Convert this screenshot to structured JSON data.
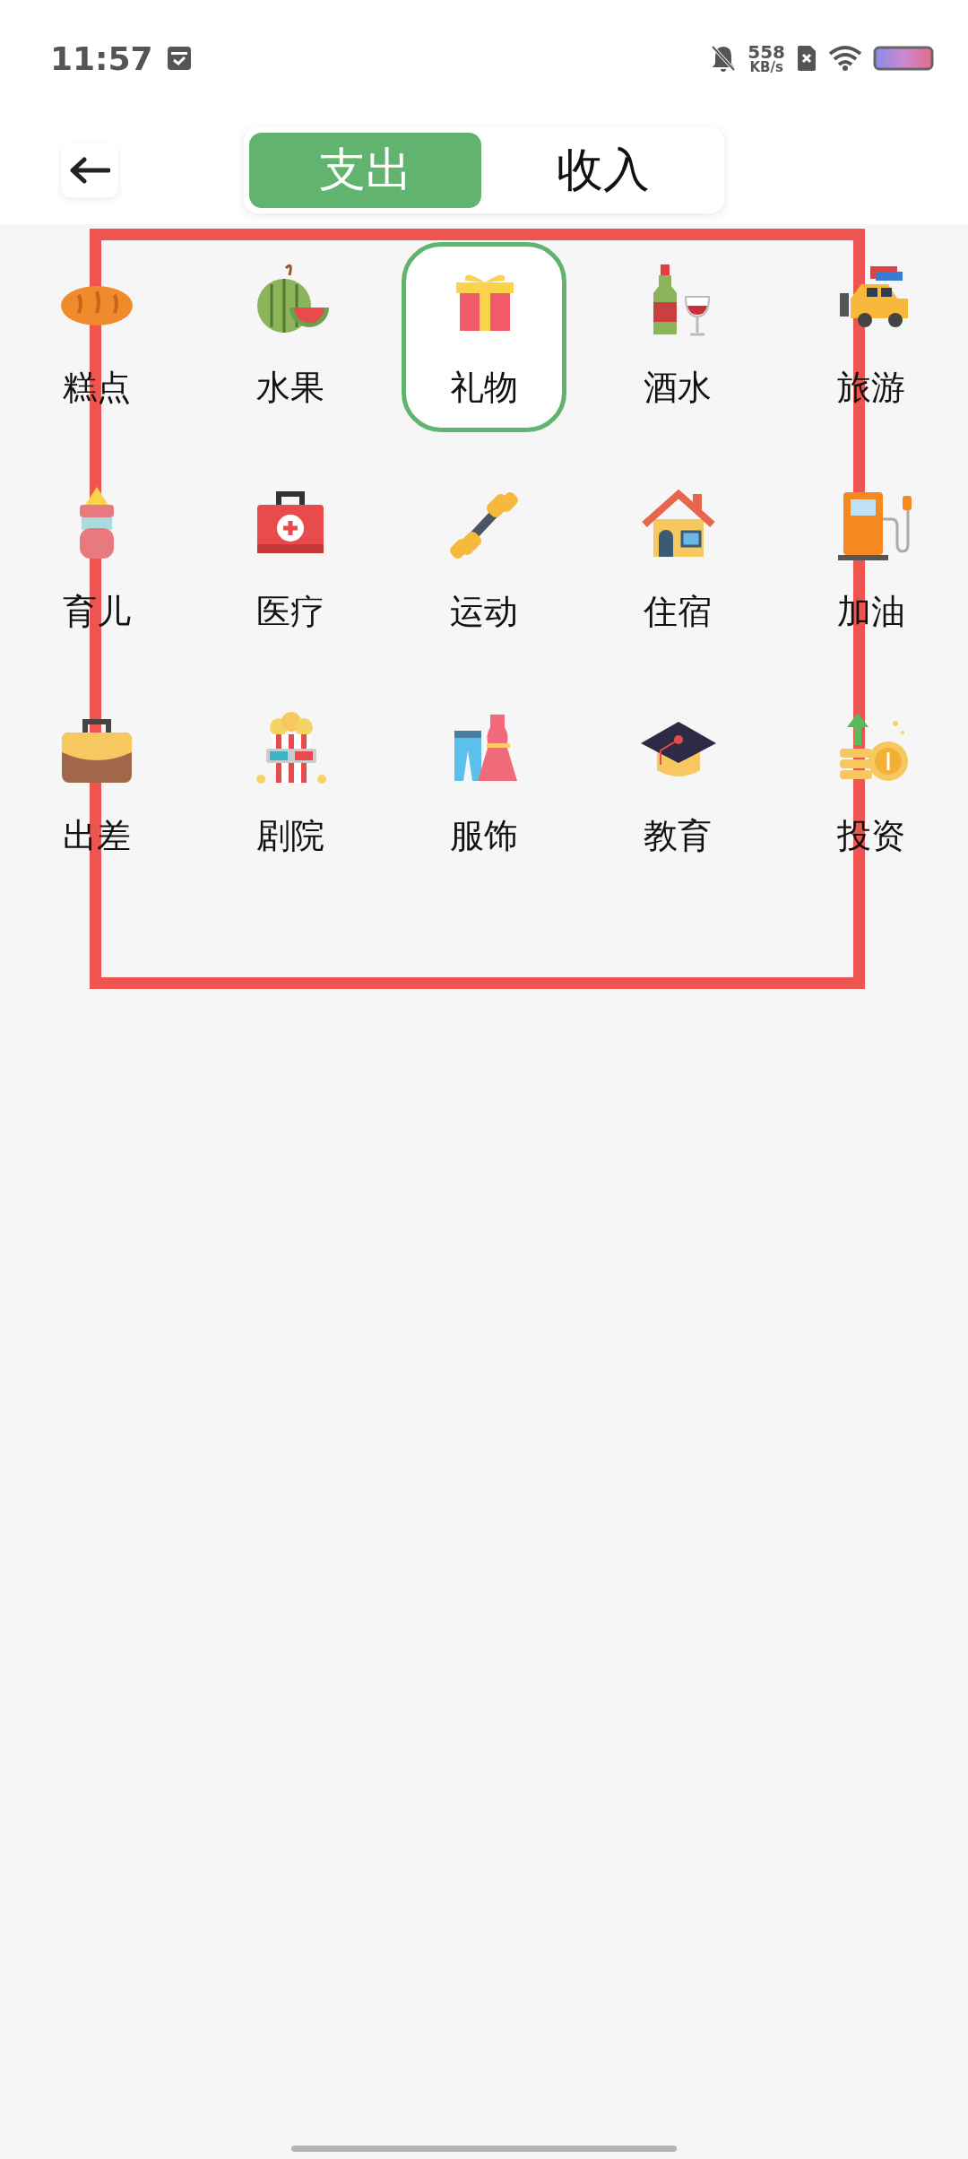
{
  "status_bar": {
    "time": "11:57",
    "speed_value": "558",
    "speed_unit": "KB/s"
  },
  "header": {
    "tabs": [
      {
        "label": "支出",
        "selected": true
      },
      {
        "label": "收入",
        "selected": false
      }
    ]
  },
  "categories": [
    {
      "label": "糕点",
      "selected": false
    },
    {
      "label": "水果",
      "selected": false
    },
    {
      "label": "礼物",
      "selected": true
    },
    {
      "label": "酒水",
      "selected": false
    },
    {
      "label": "旅游",
      "selected": false
    },
    {
      "label": "育儿",
      "selected": false
    },
    {
      "label": "医疗",
      "selected": false
    },
    {
      "label": "运动",
      "selected": false
    },
    {
      "label": "住宿",
      "selected": false
    },
    {
      "label": "加油",
      "selected": false
    },
    {
      "label": "出差",
      "selected": false
    },
    {
      "label": "剧院",
      "selected": false
    },
    {
      "label": "服饰",
      "selected": false
    },
    {
      "label": "教育",
      "selected": false
    },
    {
      "label": "投资",
      "selected": false
    }
  ]
}
